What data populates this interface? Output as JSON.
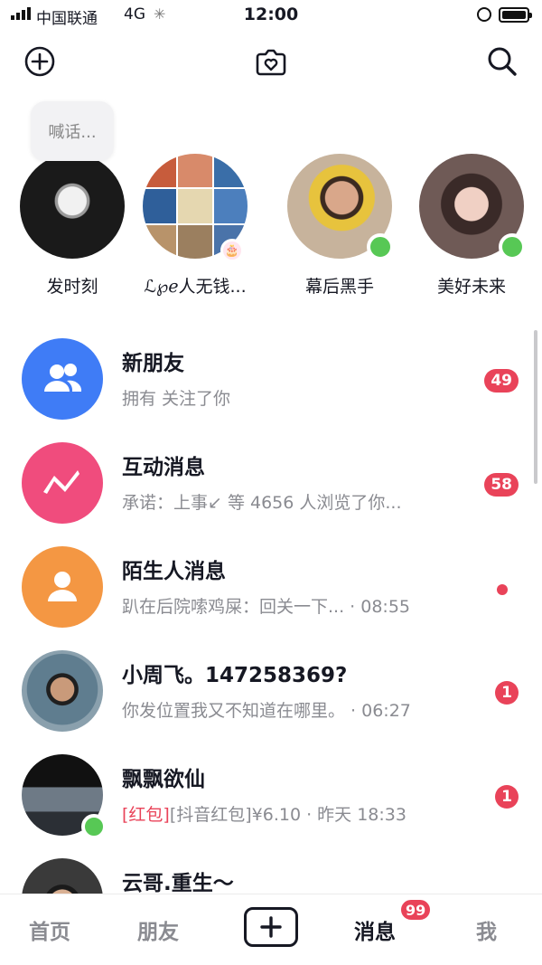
{
  "status_bar": {
    "carrier": "中国联通",
    "network": "4G",
    "time": "12:00"
  },
  "top_nav": {
    "left_icon": "plus-circle-icon",
    "center_icon": "moment-camera-icon",
    "right_icon": "search-icon"
  },
  "stories": {
    "shout_placeholder": "喊话...",
    "items": [
      {
        "name": "发时刻",
        "online": false
      },
      {
        "name": "ℒ℘ℯ人无钱...",
        "online": false
      },
      {
        "name": "幕后黑手",
        "online": true
      },
      {
        "name": "美好未来",
        "online": true
      }
    ]
  },
  "messages": [
    {
      "title": "新朋友",
      "subtitle": "拥有 关注了你",
      "badge": "49",
      "icon": "users-icon",
      "color": "#3f7cf6"
    },
    {
      "title": "互动消息",
      "subtitle": "承诺：上事↙ 等 4656 人浏览了你...",
      "badge": "58",
      "icon": "interaction-zigzag-icon",
      "color": "#f04c7d"
    },
    {
      "title": "陌生人消息",
      "subtitle": "趴在后院嗦鸡屎：回关一下... · 08:55",
      "badge": "",
      "icon": "person-icon",
      "color": "#f49743"
    },
    {
      "title": "小周飞。147258369?",
      "subtitle": "你发位置我又不知道在哪里。 · 06:27",
      "badge": "1"
    },
    {
      "title": "飘飘欲仙",
      "subtitle_red": "[红包]",
      "subtitle": "[抖音红包]¥6.10 · 昨天 18:33",
      "badge": "1",
      "online": true
    },
    {
      "title": "云哥.重生～"
    }
  ],
  "tabbar": {
    "tabs": [
      "首页",
      "朋友",
      "消息",
      "我"
    ],
    "active": "消息",
    "message_badge": "99",
    "plus_icon": "plus-icon"
  },
  "colors": {
    "badge_red": "#e94359",
    "online_green": "#57c855"
  }
}
